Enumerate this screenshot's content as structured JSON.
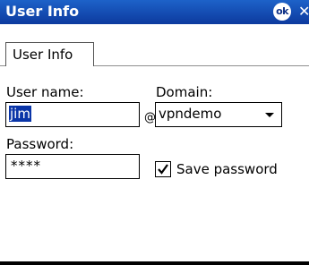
{
  "window": {
    "title": "User Info",
    "ok_label": "ok",
    "close_label": "✕",
    "titlebar_color": "#0d3a9e"
  },
  "tabs": [
    {
      "label": "User Info",
      "selected": true
    }
  ],
  "form": {
    "username_label": "User name:",
    "username_value": "jim",
    "at_symbol": "@",
    "domain_label": "Domain:",
    "domain_value": "vpndemo",
    "password_label": "Password:",
    "password_value": "****",
    "save_password_label": "Save password",
    "save_password_checked": true
  }
}
